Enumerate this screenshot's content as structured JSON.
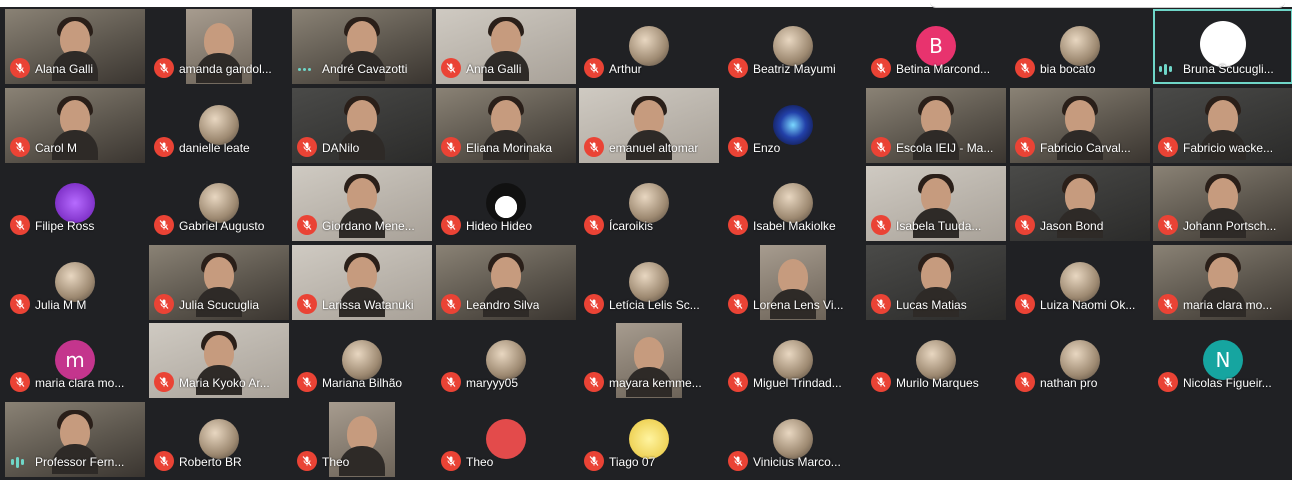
{
  "colors": {
    "background": "#202124",
    "tile": "#3c4043",
    "muted_mic": "#ea4335",
    "active_speaker": "#6fd6c8",
    "avatar_pink": "#e8336e",
    "avatar_magenta": "#c4358d",
    "avatar_teal": "#16a5a0"
  },
  "participants": [
    {
      "name": "Alana Galli",
      "muted": true,
      "kind": "photo"
    },
    {
      "name": "amanda gandol...",
      "muted": true,
      "kind": "partial"
    },
    {
      "name": "André Cavazotti",
      "muted": false,
      "kind": "photo",
      "status": "dots"
    },
    {
      "name": "Anna Galli",
      "muted": true,
      "kind": "light"
    },
    {
      "name": "Arthur",
      "muted": true,
      "kind": "avatar",
      "icon": "dog-avatar-icon"
    },
    {
      "name": "Beatriz Mayumi",
      "muted": true,
      "kind": "avatar",
      "icon": "puppy-avatar-icon"
    },
    {
      "name": "Betina Marcond...",
      "muted": true,
      "kind": "letter",
      "letter": "B",
      "color": "#e8336e"
    },
    {
      "name": "bia bocato",
      "muted": true,
      "kind": "avatar",
      "icon": "art-avatar-icon"
    },
    {
      "name": "Bruna Scucugli...",
      "muted": false,
      "kind": "avatar",
      "icon": "panda-avatar-icon",
      "status": "speaking",
      "active": true
    },
    {
      "name": "Carol M",
      "muted": true,
      "kind": "photo"
    },
    {
      "name": "danielle leate",
      "muted": true,
      "kind": "avatar",
      "icon": "portrait-avatar-icon"
    },
    {
      "name": "DANilo",
      "muted": true,
      "kind": "dark"
    },
    {
      "name": "Eliana Morinaka",
      "muted": true,
      "kind": "photo"
    },
    {
      "name": "emanuel altomar",
      "muted": true,
      "kind": "light"
    },
    {
      "name": "Enzo",
      "muted": true,
      "kind": "avatar",
      "icon": "galaxy-avatar-icon"
    },
    {
      "name": "Escola IEIJ - Ma...",
      "muted": true,
      "kind": "photo"
    },
    {
      "name": "Fabricio Carval...",
      "muted": true,
      "kind": "photo"
    },
    {
      "name": "Fabricio wacke...",
      "muted": true,
      "kind": "dark"
    },
    {
      "name": "Filipe Ross",
      "muted": true,
      "kind": "avatar",
      "icon": "purple-alien-avatar-icon"
    },
    {
      "name": "Gabriel Augusto",
      "muted": true,
      "kind": "avatar",
      "icon": "leaf-emblem-avatar-icon"
    },
    {
      "name": "Giordano Mene...",
      "muted": true,
      "kind": "light"
    },
    {
      "name": "Hideo Hideo",
      "muted": true,
      "kind": "avatar",
      "icon": "penguin-avatar-icon"
    },
    {
      "name": "Ícaroikis",
      "muted": true,
      "kind": "avatar",
      "icon": "anime-avatar-icon"
    },
    {
      "name": "Isabel Makiolke",
      "muted": true,
      "kind": "avatar",
      "icon": "mandala-avatar-icon"
    },
    {
      "name": "Isabela Tuuda...",
      "muted": true,
      "kind": "light"
    },
    {
      "name": "Jason Bond",
      "muted": true,
      "kind": "dark"
    },
    {
      "name": "Johann Portsch...",
      "muted": true,
      "kind": "photo"
    },
    {
      "name": "Julia M M",
      "muted": true,
      "kind": "avatar",
      "icon": "anime-girl-avatar-icon"
    },
    {
      "name": "Julia Scucuglia",
      "muted": true,
      "kind": "photo"
    },
    {
      "name": "Larissa Watanuki",
      "muted": true,
      "kind": "light"
    },
    {
      "name": "Leandro Silva",
      "muted": true,
      "kind": "photo"
    },
    {
      "name": "Letícia Lelis Sc...",
      "muted": true,
      "kind": "avatar",
      "icon": "anime-boy-avatar-icon"
    },
    {
      "name": "Lorena Lens Vi...",
      "muted": true,
      "kind": "partial"
    },
    {
      "name": "Lucas Matias",
      "muted": true,
      "kind": "dark"
    },
    {
      "name": "Luiza Naomi Ok...",
      "muted": true,
      "kind": "avatar",
      "icon": "bokeh-avatar-icon"
    },
    {
      "name": "maria clara mo...",
      "muted": true,
      "kind": "photo"
    },
    {
      "name": "maria clara mo...",
      "muted": true,
      "kind": "letter",
      "letter": "m",
      "color": "#c4358d"
    },
    {
      "name": "Maria Kyoko Ar...",
      "muted": true,
      "kind": "light"
    },
    {
      "name": "Mariana Bilhão",
      "muted": true,
      "kind": "avatar",
      "icon": "anime-character-avatar-icon"
    },
    {
      "name": "maryyy05",
      "muted": true,
      "kind": "avatar",
      "icon": "anime-blue-avatar-icon"
    },
    {
      "name": "mayara kemme...",
      "muted": true,
      "kind": "partial"
    },
    {
      "name": "Miguel Trindad...",
      "muted": true,
      "kind": "avatar",
      "icon": "child-avatar-icon"
    },
    {
      "name": "Murilo Marques",
      "muted": true,
      "kind": "avatar",
      "icon": "ninja-avatar-icon"
    },
    {
      "name": "nathan pro",
      "muted": true,
      "kind": "avatar",
      "icon": "gamer-avatar-icon"
    },
    {
      "name": "Nicolas Figueir...",
      "muted": true,
      "kind": "letter",
      "letter": "N",
      "color": "#16a5a0"
    },
    {
      "name": "Professor Fern...",
      "muted": false,
      "kind": "photo",
      "status": "speaking"
    },
    {
      "name": "Roberto BR",
      "muted": true,
      "kind": "avatar",
      "icon": "cat-avatar-icon"
    },
    {
      "name": "Theo",
      "muted": true,
      "kind": "partial"
    },
    {
      "name": "Theo",
      "muted": true,
      "kind": "avatar",
      "icon": "mustache-avatar-icon"
    },
    {
      "name": "Tiago 07",
      "muted": true,
      "kind": "avatar",
      "icon": "chick-avatar-icon"
    },
    {
      "name": "Vinicius Marco...",
      "muted": true,
      "kind": "avatar",
      "icon": "portrait-painting-avatar-icon"
    }
  ]
}
